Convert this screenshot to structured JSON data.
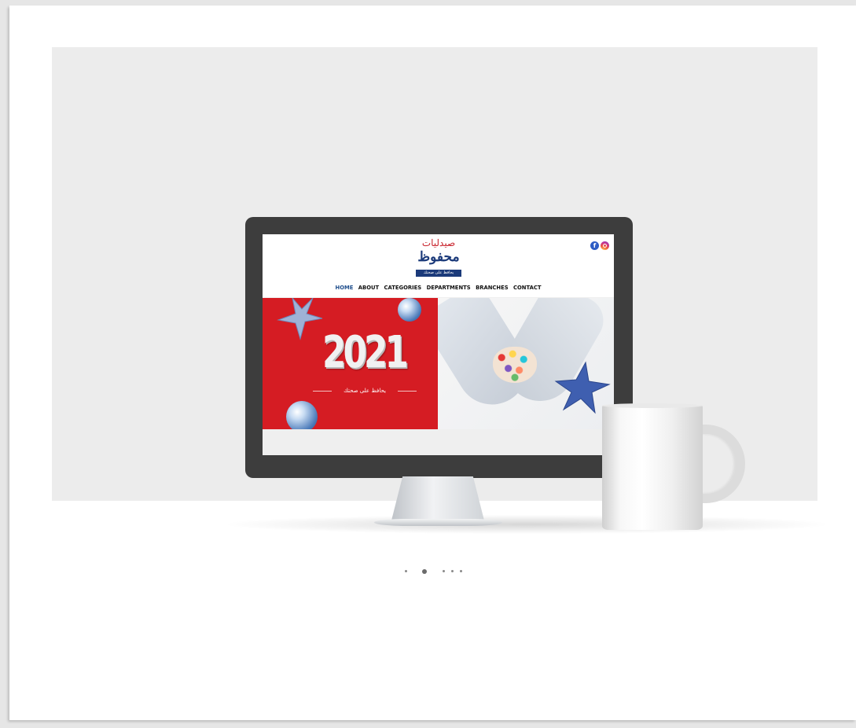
{
  "site": {
    "logo": {
      "top_text": "صيدليات",
      "main_text": "محفوظ",
      "tagline": "يحافظ على صحتك"
    },
    "social": [
      {
        "icon": "facebook-icon",
        "label": "f"
      },
      {
        "icon": "instagram-icon"
      }
    ],
    "nav": [
      {
        "label": "HOME",
        "active": true
      },
      {
        "label": "ABOUT"
      },
      {
        "label": "CATEGORIES"
      },
      {
        "label": "DEPARTMENTS"
      },
      {
        "label": "BRANCHES"
      },
      {
        "label": "CONTACT"
      }
    ],
    "banner": {
      "year": "2021",
      "tagline": "يحافظ على صحتك"
    }
  },
  "carousel": {
    "slides": 5,
    "active_index": 1
  },
  "colors": {
    "accent_blue": "#1f4e8c",
    "banner_red": "#d51c23",
    "logo_navy": "#1b3a7a"
  }
}
